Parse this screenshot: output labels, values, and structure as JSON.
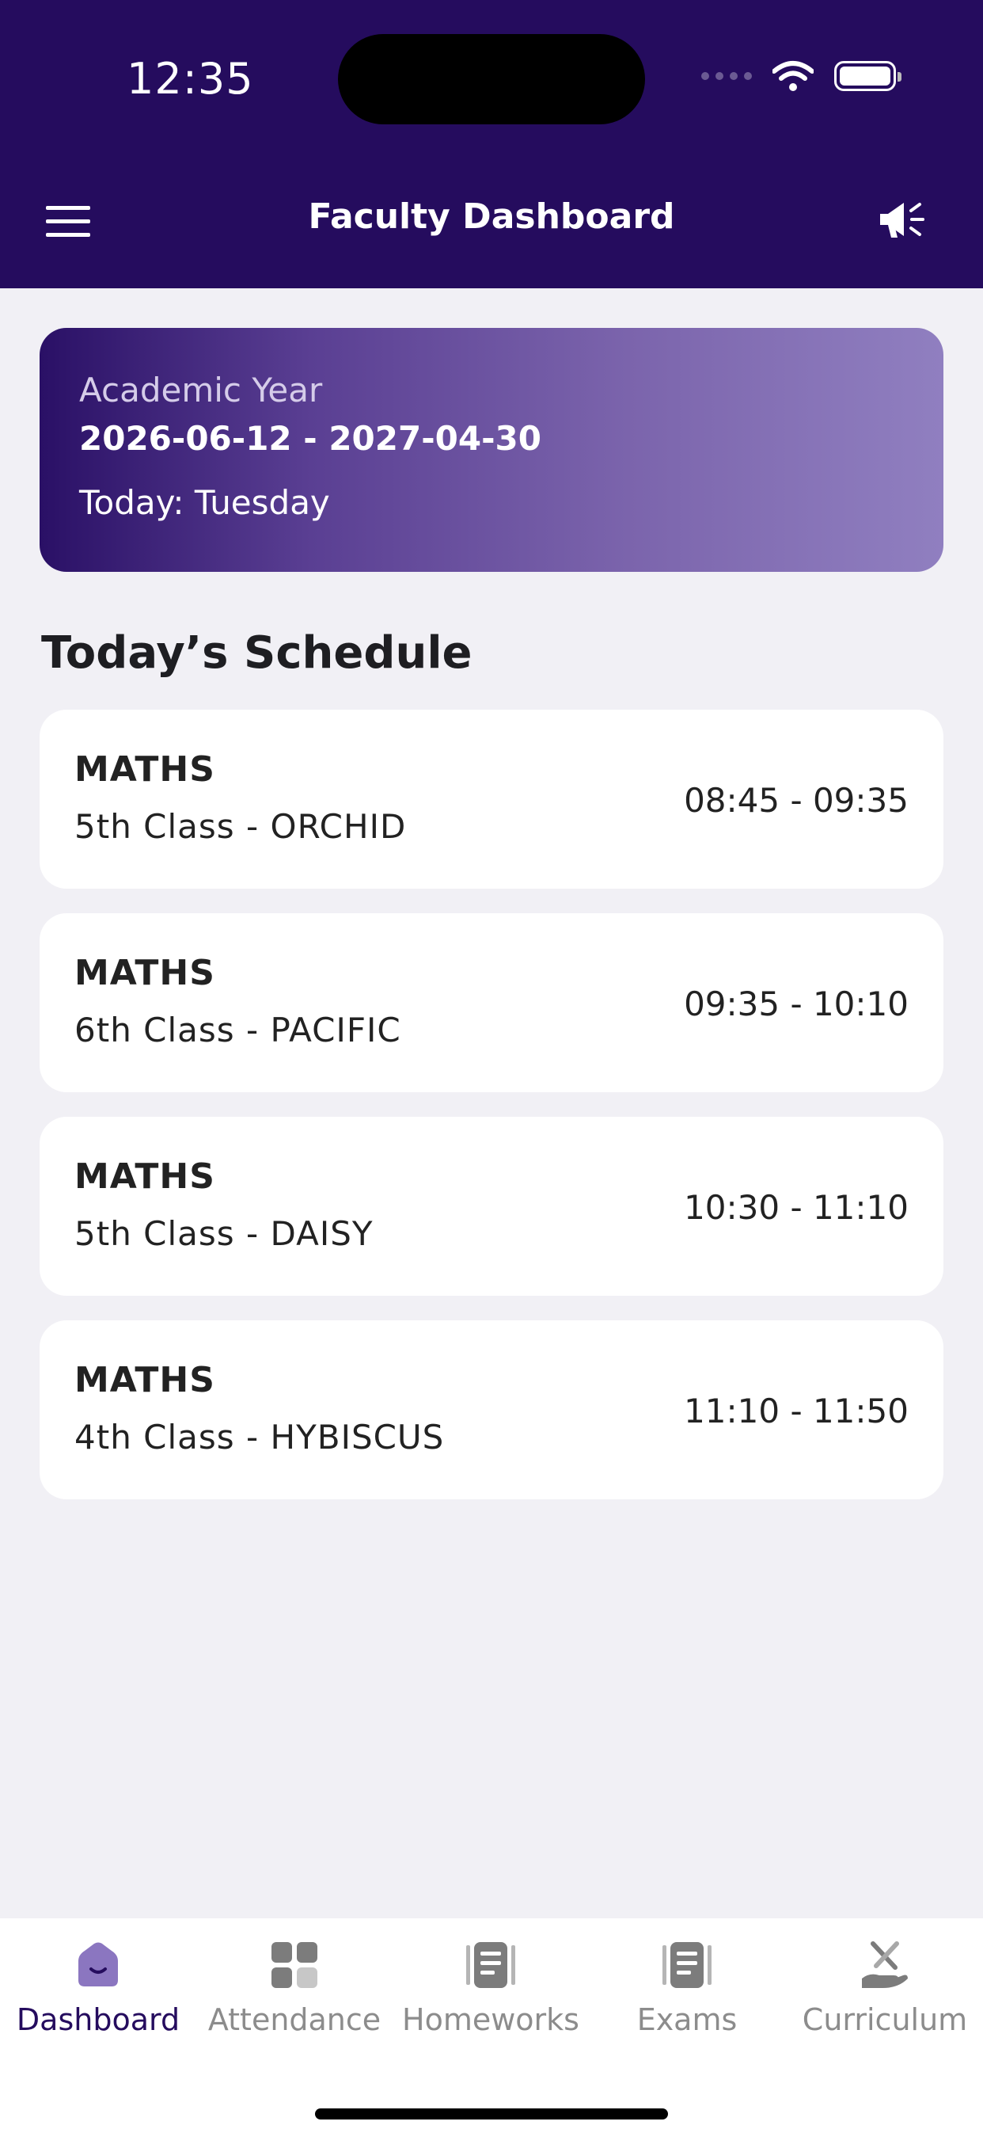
{
  "status_bar": {
    "time": "12:35"
  },
  "header": {
    "title": "Faculty Dashboard"
  },
  "academic_year": {
    "label": "Academic Year",
    "range": "2026-06-12 - 2027-04-30",
    "today": "Today: Tuesday"
  },
  "schedule": {
    "title": "Today’s Schedule",
    "items": [
      {
        "subject": "MATHS",
        "class": "5th Class - ORCHID",
        "time": "08:45 - 09:35"
      },
      {
        "subject": "MATHS",
        "class": "6th Class - PACIFIC",
        "time": "09:35 - 10:10"
      },
      {
        "subject": "MATHS",
        "class": "5th Class - DAISY",
        "time": "10:30 - 11:10"
      },
      {
        "subject": "MATHS",
        "class": "4th Class - HYBISCUS",
        "time": "11:10 - 11:50"
      }
    ]
  },
  "tabs": [
    {
      "label": "Dashboard",
      "icon": "home-icon",
      "active": true
    },
    {
      "label": "Attendance",
      "icon": "grid-icon",
      "active": false
    },
    {
      "label": "Homeworks",
      "icon": "document-icon",
      "active": false
    },
    {
      "label": "Exams",
      "icon": "document-icon",
      "active": false
    },
    {
      "label": "Curriculum",
      "icon": "tools-hand-icon",
      "active": false
    }
  ],
  "colors": {
    "header": "#250c5e",
    "accent": "#7b64ac",
    "background": "#f1f0f5"
  }
}
